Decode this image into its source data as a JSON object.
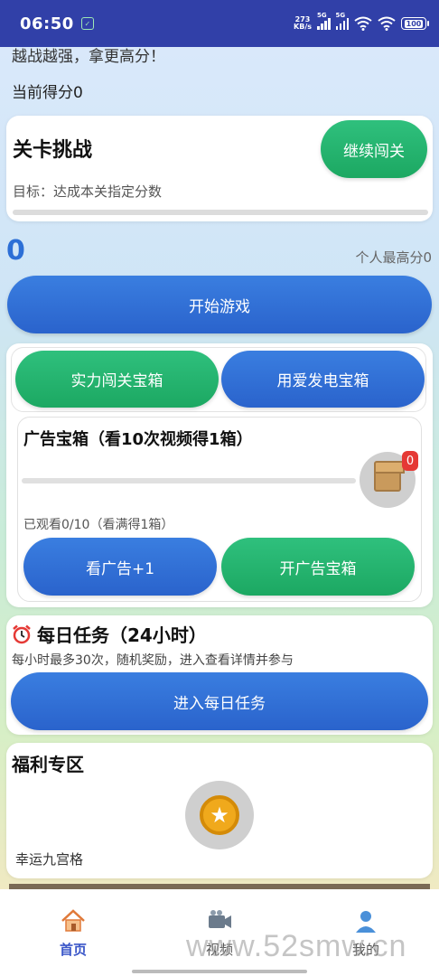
{
  "status": {
    "time": "06:50",
    "net_speed_value": "273",
    "net_speed_unit": "KB/s",
    "sim1_label": "5G",
    "sim2_label": "5G",
    "battery": "100"
  },
  "intro": {
    "text": "越战越强，拿更高分！",
    "current_score_label": "当前得分0"
  },
  "level": {
    "title": "关卡挑战",
    "goal": "目标：达成本关指定分数",
    "continue_label": "继续闯关",
    "progress_fraction": 0
  },
  "score": {
    "value": "0",
    "best_label": "个人最高分0"
  },
  "start_label": "开始游戏",
  "treasure": {
    "tab_strength": "实力闯关宝箱",
    "tab_love": "用爱发电宝箱",
    "ad_title": "广告宝箱（看10次视频得1箱）",
    "ad_badge": "0",
    "ad_watched": "已观看0/10（看满得1箱）",
    "watch_ad_label": "看广告+1",
    "open_ad_chest_label": "开广告宝箱",
    "ad_progress_fraction": 0
  },
  "daily": {
    "title": "每日任务（24小时）",
    "desc": "每小时最多30次，随机奖励，进入查看详情并参与",
    "enter_label": "进入每日任务"
  },
  "welfare": {
    "title": "福利专区",
    "lucky_label": "幸运九宫格"
  },
  "nav": {
    "home": "首页",
    "video": "视频",
    "mine": "我的"
  },
  "watermark": "www.52smw.cn",
  "colors": {
    "status_bar": "#3140a8",
    "green": "#1ca862",
    "blue": "#2a63cc",
    "active_nav": "#3a56c8"
  }
}
